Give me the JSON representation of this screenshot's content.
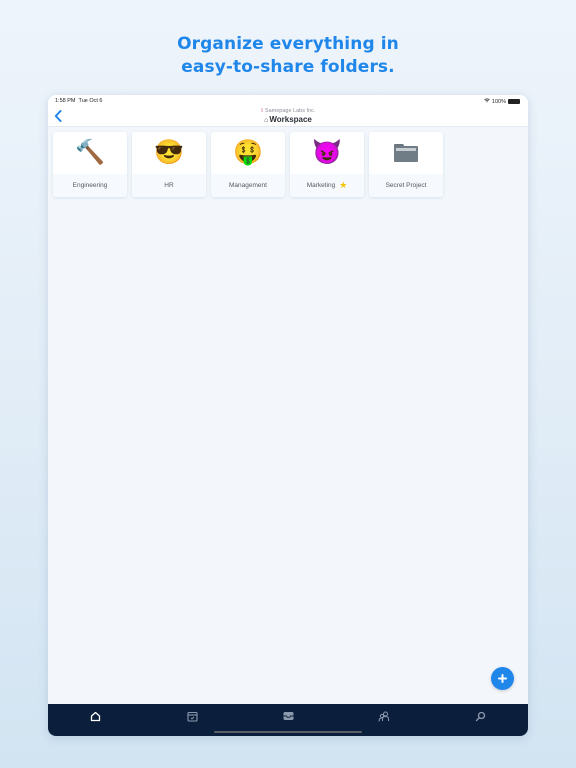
{
  "headline": {
    "line1": "Organize everything in",
    "line2": "easy-to-share folders."
  },
  "status_bar": {
    "time": "1:58 PM",
    "date": "Tue Oct 6",
    "battery": "100%"
  },
  "nav": {
    "org_name": "Samepage Labs Inc.",
    "title": "Workspace",
    "back_icon": "chevron-left-icon"
  },
  "folders": [
    {
      "label": "Engineering",
      "icon": "🔨",
      "icon_name": "hammer-icon",
      "starred": false
    },
    {
      "label": "HR",
      "icon": "😎",
      "icon_name": "sunglasses-face-icon",
      "starred": false
    },
    {
      "label": "Management",
      "icon": "🤑",
      "icon_name": "money-mouth-face-icon",
      "starred": false
    },
    {
      "label": "Marketing",
      "icon": "😈",
      "icon_name": "smiling-devil-icon",
      "starred": true
    },
    {
      "label": "Secret Project",
      "icon": "folder",
      "icon_name": "folder-icon",
      "starred": false
    }
  ],
  "fab": {
    "icon": "+",
    "icon_name": "plus-icon"
  },
  "tabbar": [
    {
      "name": "home",
      "icon": "home-icon",
      "active": true
    },
    {
      "name": "calendar",
      "icon": "calendar-icon",
      "active": false
    },
    {
      "name": "inbox",
      "icon": "inbox-icon",
      "active": false
    },
    {
      "name": "people",
      "icon": "people-icon",
      "active": false
    },
    {
      "name": "search",
      "icon": "search-icon",
      "active": false
    }
  ],
  "colors": {
    "accent": "#1f86ea",
    "tabbar_bg": "#0b1f3d",
    "star": "#f4c400"
  }
}
